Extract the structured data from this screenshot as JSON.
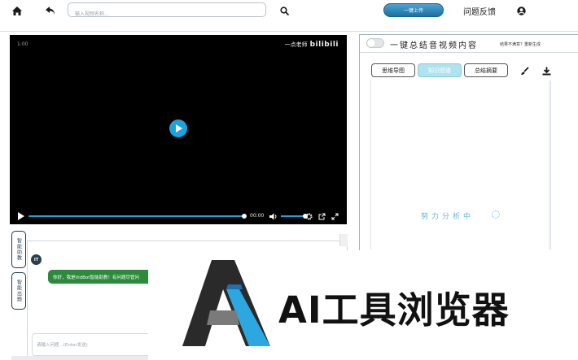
{
  "topbar": {
    "home_icon": "home-icon",
    "back_icon": "back-arrow-icon",
    "search_placeholder": "输入视频名称...",
    "search_icon": "search-icon",
    "upload_label": "一键上传",
    "feedback_label": "问题反馈",
    "user_icon": "user-circle-icon"
  },
  "video": {
    "corner_time": "1:00",
    "brand_cn": "一点老师",
    "brand_logo": "bilibili",
    "current_time": "00:00",
    "progress": 1.0,
    "volume": 1.0,
    "accent": "#1ba3dc"
  },
  "side_tabs": [
    "智能助教",
    "智能出题"
  ],
  "chat": {
    "avatar_text": "IT",
    "bot_message": "你好，我是VidBot智能助教！有问题尽管问",
    "input_placeholder": "请输入问题...(Enter发送)"
  },
  "panel": {
    "title": "一键总结音视频内容",
    "subtitle": "结果不满意？重新生成",
    "tabs": [
      {
        "label": "思维导图",
        "active": false
      },
      {
        "label": "知识图谱",
        "active": true
      },
      {
        "label": "总结摘要",
        "active": false
      }
    ],
    "brush_icon": "brush-icon",
    "download_icon": "download-icon",
    "loading_text": "努力分析中"
  },
  "watermark": {
    "text": "AI工具浏览器"
  }
}
